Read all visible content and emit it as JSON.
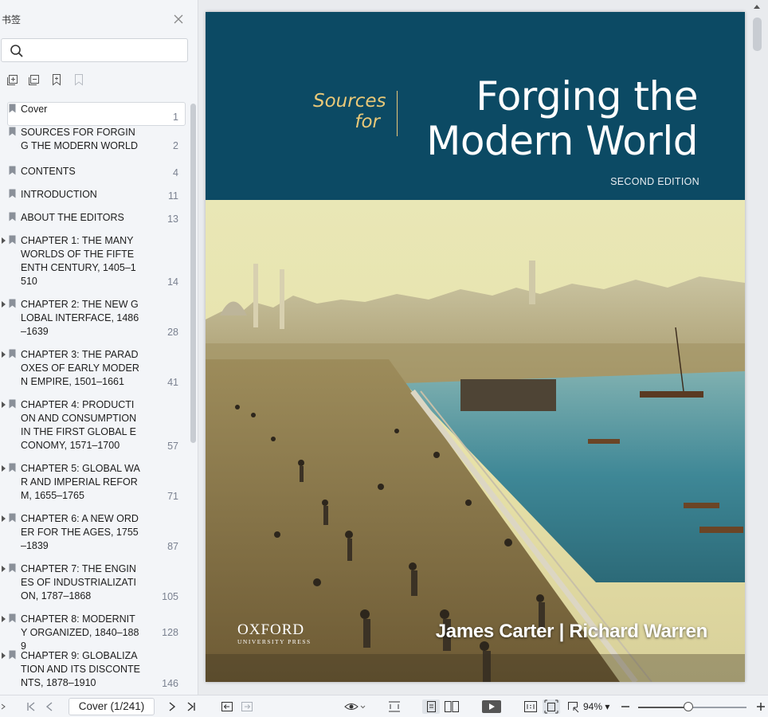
{
  "sidebar": {
    "title": "书签",
    "search_placeholder": "",
    "bookmarks": [
      {
        "label": "Cover",
        "page": "1",
        "expandable": false,
        "selected": true
      },
      {
        "label": "SOURCES FOR FORGING THE MODERN WORLD",
        "page": "2",
        "expandable": false
      },
      {
        "label": "CONTENTS",
        "page": "4",
        "expandable": false
      },
      {
        "label": "INTRODUCTION",
        "page": "11",
        "expandable": false
      },
      {
        "label": "ABOUT THE EDITORS",
        "page": "13",
        "expandable": false
      },
      {
        "label": "CHAPTER 1: THE MANY WORLDS OF THE FIFTEENTH CENTURY, 1405–1510",
        "page": "14",
        "expandable": true
      },
      {
        "label": "CHAPTER 2: THE NEW GLOBAL INTERFACE, 1486–1639",
        "page": "28",
        "expandable": true
      },
      {
        "label": "CHAPTER 3: THE PARADOXES OF EARLY MODERN EMPIRE, 1501–1661",
        "page": "41",
        "expandable": true
      },
      {
        "label": "CHAPTER 4: PRODUCTION AND CONSUMPTION IN THE FIRST GLOBAL ECONOMY, 1571–1700",
        "page": "57",
        "expandable": true
      },
      {
        "label": "CHAPTER 5: GLOBAL WAR AND IMPERIAL REFORM, 1655–1765",
        "page": "71",
        "expandable": true
      },
      {
        "label": "CHAPTER 6: A NEW ORDER FOR THE AGES, 1755–1839",
        "page": "87",
        "expandable": true
      },
      {
        "label": "CHAPTER 7: THE ENGINES OF INDUSTRIALIZATION, 1787–1868",
        "page": "105",
        "expandable": true
      },
      {
        "label": "CHAPTER 8: MODERNITY ORGANIZED, 1840–1889",
        "page": "128",
        "expandable": true
      },
      {
        "label": "CHAPTER 9: GLOBALIZATION AND ITS DISCONTENTS, 1878–1910",
        "page": "146",
        "expandable": true
      }
    ]
  },
  "cover": {
    "sources": "Sources",
    "for": "for",
    "title_line1": "Forging the",
    "title_line2": "Modern World",
    "edition": "SECOND EDITION",
    "publisher": "OXFORD",
    "publisher_sub": "UNIVERSITY PRESS",
    "authors": "James Carter | Richard Warren",
    "colors": {
      "band": "#0c4a64",
      "accent": "#e9c878"
    }
  },
  "toolbar": {
    "page_indicator": "Cover (1/241)",
    "zoom": "94%",
    "zoom_level": 0.46
  }
}
